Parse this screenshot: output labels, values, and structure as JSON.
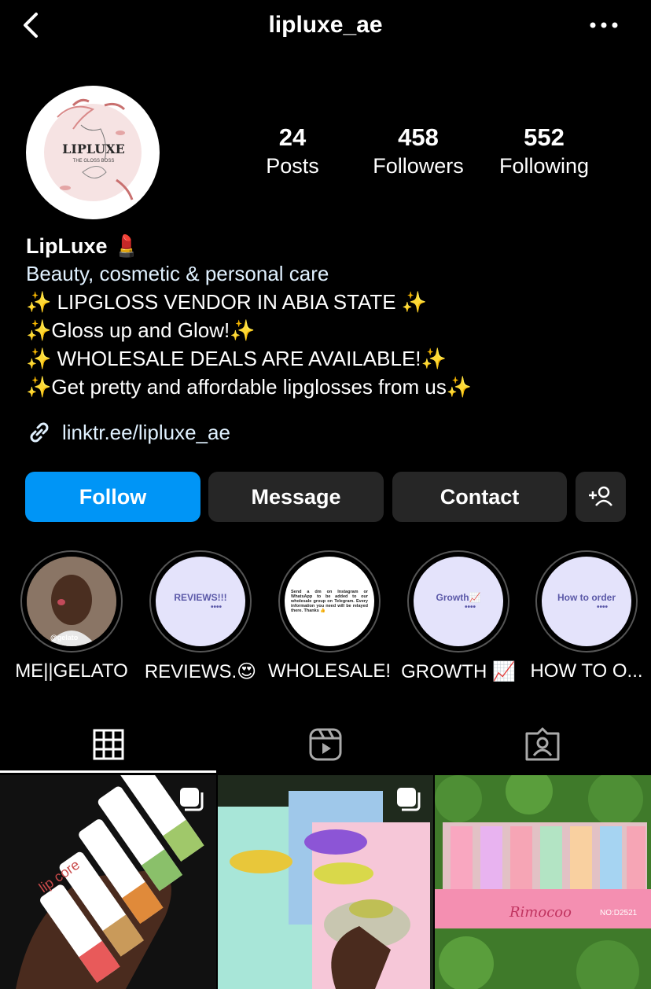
{
  "header": {
    "username": "lipluxe_ae"
  },
  "avatar": {
    "brand": "LIPLUXE",
    "tagline": "THE GLOSS BOSS"
  },
  "stats": [
    {
      "num": "24",
      "label": "Posts"
    },
    {
      "num": "458",
      "label": "Followers"
    },
    {
      "num": "552",
      "label": "Following"
    }
  ],
  "bio": {
    "name": "LipLuxe 💄",
    "category": "Beauty, cosmetic & personal care",
    "lines": [
      "✨ LIPGLOSS VENDOR IN ABIA STATE ✨",
      "✨Gloss up and Glow!✨",
      "✨ WHOLESALE DEALS ARE AVAILABLE!✨",
      "✨Get pretty and affordable lipglosses from us✨"
    ],
    "link": "linktr.ee/lipluxe_ae"
  },
  "buttons": {
    "follow": "Follow",
    "message": "Message",
    "contact": "Contact"
  },
  "highlights": [
    {
      "caption": "ME||GELATO",
      "cover_text": "@gelato"
    },
    {
      "caption": "REVIEWS.😍",
      "cover_text": "REVIEWS!!!"
    },
    {
      "caption": "WHOLESALE!",
      "cover_text": "Send a dm on Instagram or WhatsApp to be added to our wholesale group on Telegram. Every information you need will be relayed there. Thanks 👍"
    },
    {
      "caption": "GROWTH 📈",
      "cover_text": "Growth📈"
    },
    {
      "caption": "HOW TO O...",
      "cover_text": "How to order"
    }
  ],
  "posts": [
    {
      "label": "lip core",
      "brand_text": "Rimocoo"
    }
  ],
  "post_texts": {
    "p1": "lip core",
    "p3a": "Rimocoo",
    "p3b": "NO:D2521"
  },
  "colors": {
    "accent": "#0095f6",
    "button_bg": "#262626",
    "highlight_bg": "#e4e3fb"
  }
}
